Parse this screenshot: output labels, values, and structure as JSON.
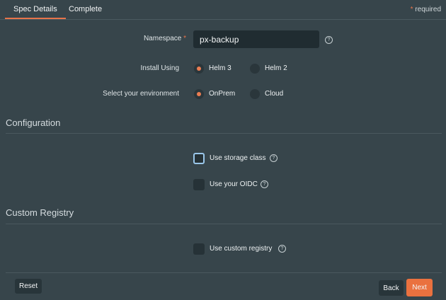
{
  "tabs": [
    {
      "label": "Spec Details"
    },
    {
      "label": "Complete"
    }
  ],
  "required_note": {
    "star": "*",
    "text": " required"
  },
  "namespace": {
    "label": "Namespace",
    "required_star": "*",
    "value": "px-backup",
    "help_glyph": "?"
  },
  "install_using": {
    "label": "Install Using",
    "options": [
      {
        "label": "Helm 3",
        "selected": true
      },
      {
        "label": "Helm 2",
        "selected": false
      }
    ]
  },
  "environment": {
    "label": "Select your environment",
    "options": [
      {
        "label": "OnPrem",
        "selected": true
      },
      {
        "label": "Cloud",
        "selected": false
      }
    ]
  },
  "configuration": {
    "title": "Configuration",
    "items": [
      {
        "label": "Use storage class",
        "checked": false,
        "focused": true,
        "help_glyph": "?"
      },
      {
        "label": "Use your OIDC",
        "checked": false,
        "focused": false,
        "help_glyph": "?"
      }
    ]
  },
  "custom_registry": {
    "title": "Custom Registry",
    "items": [
      {
        "label": "Use custom registry",
        "checked": false,
        "help_glyph": "?"
      }
    ]
  },
  "footer": {
    "reset_label": "Reset",
    "back_label": "Back",
    "next_label": "Next"
  },
  "colors": {
    "background": "#37454b",
    "accent": "#ea713f",
    "focus": "#9ac7ea"
  }
}
